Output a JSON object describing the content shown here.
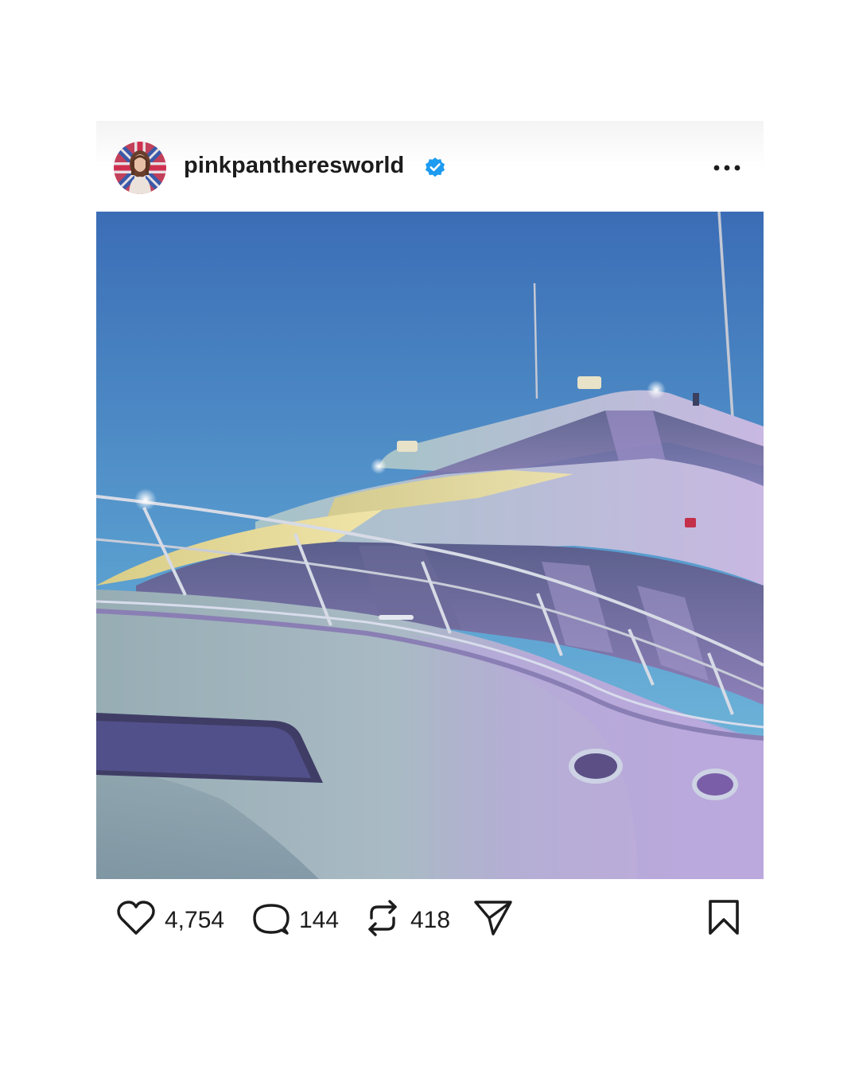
{
  "post": {
    "username": "pinkpantheresworld",
    "verified": true,
    "more_icon": "more-horizontal-icon",
    "image_alt": "Illustration of a white yacht against a blue sky",
    "actions": {
      "likes": "4,754",
      "comments": "144",
      "reposts": "418"
    }
  },
  "colors": {
    "verified_badge": "#1d9bf0",
    "text": "#1c1c1c",
    "icon": "#1c1c1c"
  }
}
